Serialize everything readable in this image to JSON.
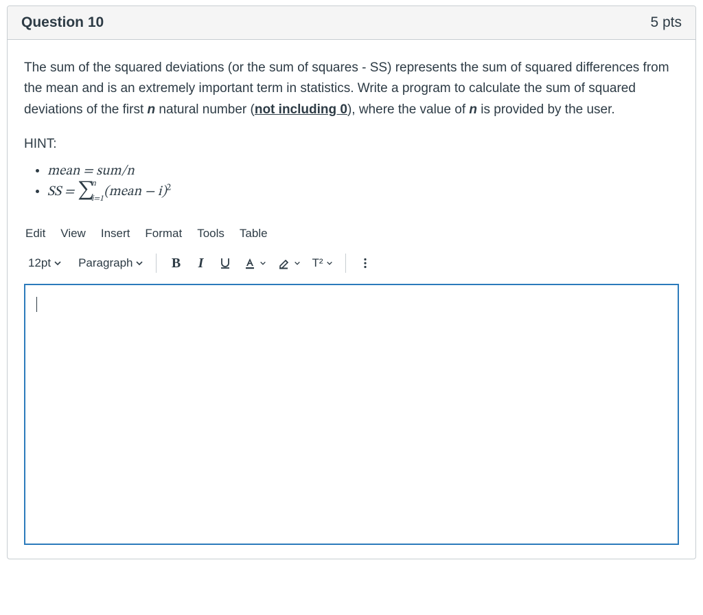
{
  "header": {
    "title": "Question 10",
    "points": "5 pts"
  },
  "prompt": {
    "p1_a": "The sum of the squared deviations (or the sum of squares - SS) represents the sum of squared differences from the mean and is an extremely important term in statistics. Write a program to calculate the sum of squared deviations of the first ",
    "p1_n": "n",
    "p1_b": " natural number (",
    "p1_underlined": "not including 0",
    "p1_c": "), where the value of ",
    "p1_n2": "n",
    "p1_d": " is provided by the user."
  },
  "hint_label": "HINT:",
  "formulas": {
    "mean": "mean = sum/n",
    "ss_lhs": "SS = ",
    "sigma_upper": "n",
    "sigma_lower": "i=1",
    "ss_rhs_a": "(mean − i)",
    "ss_rhs_exp": "2"
  },
  "menu": {
    "edit": "Edit",
    "view": "View",
    "insert": "Insert",
    "format": "Format",
    "tools": "Tools",
    "table": "Table"
  },
  "toolbar": {
    "font_size": "12pt",
    "block": "Paragraph",
    "bold": "B",
    "italic": "I",
    "super_label": "T²"
  },
  "editor": {
    "content": ""
  }
}
